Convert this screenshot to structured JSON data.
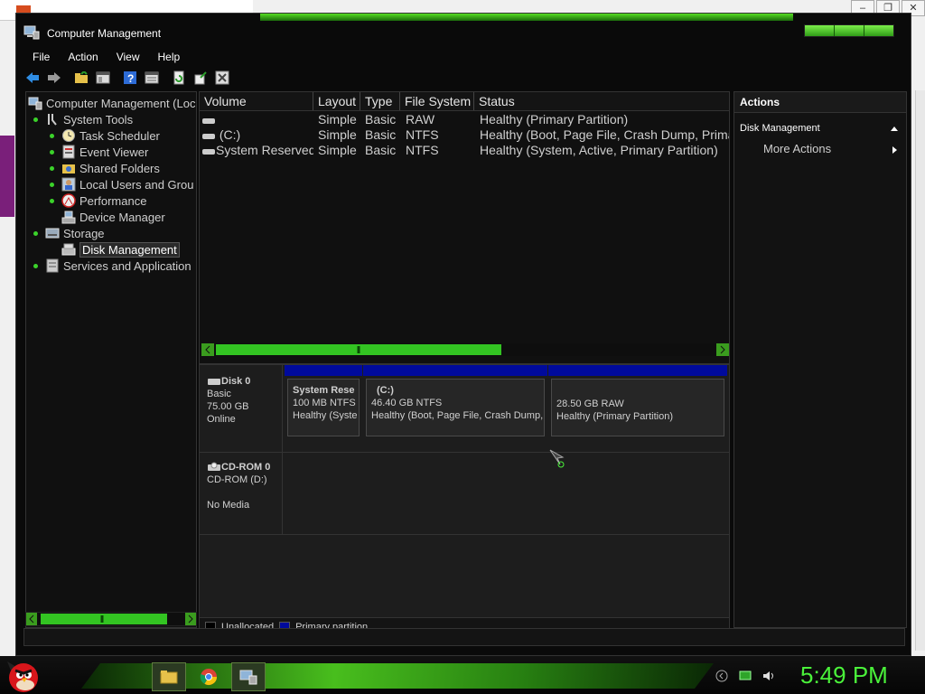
{
  "window": {
    "title": "Computer Management"
  },
  "menu": [
    "File",
    "Action",
    "View",
    "Help"
  ],
  "toolbar": {
    "icons": [
      "back-icon",
      "forward-icon",
      "up-folder-icon",
      "show-hide-tree-icon",
      "help-icon",
      "properties-icon",
      "refresh-icon",
      "export-icon",
      "settings-icon"
    ]
  },
  "tree": {
    "root": "Computer Management (Loc",
    "system_tools": "System Tools",
    "task_scheduler": "Task Scheduler",
    "event_viewer": "Event Viewer",
    "shared_folders": "Shared Folders",
    "local_users": "Local Users and Grou",
    "performance": "Performance",
    "device_manager": "Device Manager",
    "storage": "Storage",
    "disk_management": "Disk Management",
    "services": "Services and Application"
  },
  "volumes": {
    "headers": [
      "Volume",
      "Layout",
      "Type",
      "File System",
      "Status"
    ],
    "rows": [
      {
        "volume": "",
        "layout": "Simple",
        "type": "Basic",
        "fs": "RAW",
        "status": "Healthy (Primary Partition)"
      },
      {
        "volume": "(C:)",
        "layout": "Simple",
        "type": "Basic",
        "fs": "NTFS",
        "status": "Healthy (Boot, Page File, Crash Dump, Primary"
      },
      {
        "volume": "System Reserved",
        "layout": "Simple",
        "type": "Basic",
        "fs": "NTFS",
        "status": "Healthy (System, Active, Primary Partition)"
      }
    ]
  },
  "disks": {
    "disk0": {
      "name": "Disk 0",
      "type": "Basic",
      "size": "75.00 GB",
      "state": "Online",
      "partitions": [
        {
          "name": "System Rese",
          "size": "100 MB NTFS",
          "status": "Healthy (Syste"
        },
        {
          "name": "(C:)",
          "size": "46.40 GB NTFS",
          "status": "Healthy (Boot, Page File, Crash Dump, P"
        },
        {
          "name": "",
          "size": "28.50 GB RAW",
          "status": "Healthy (Primary Partition)"
        }
      ]
    },
    "cdrom0": {
      "name": "CD-ROM 0",
      "drive": "CD-ROM (D:)",
      "state": "No Media"
    }
  },
  "legend": {
    "unallocated": "Unallocated",
    "primary": "Primary partition"
  },
  "actions": {
    "title": "Actions",
    "section": "Disk Management",
    "more": "More Actions"
  },
  "taskbar": {
    "clock": "5:49 PM"
  },
  "colors": {
    "accent_green": "#4af23a",
    "partition_blue": "#000a9c"
  }
}
